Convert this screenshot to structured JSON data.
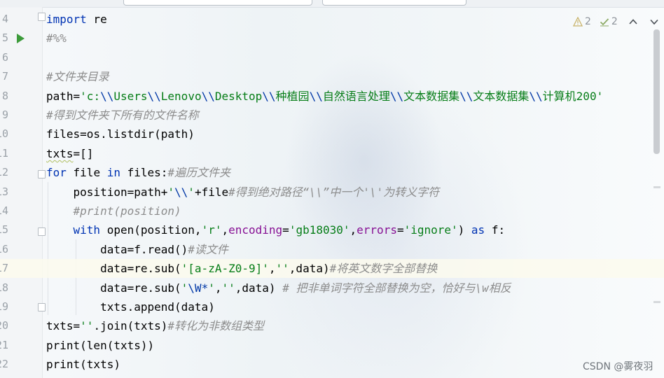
{
  "editor": {
    "lines": [
      {
        "num": "4",
        "tokens": [
          {
            "t": "import",
            "c": "kw"
          },
          {
            "t": " re",
            "c": "bi"
          }
        ]
      },
      {
        "num": "5",
        "tokens": [
          {
            "t": "#%%",
            "c": "cm"
          }
        ]
      },
      {
        "num": "6",
        "tokens": []
      },
      {
        "num": "7",
        "tokens": [
          {
            "t": "#文件夹目录",
            "c": "cm"
          }
        ]
      },
      {
        "num": "8",
        "tokens": [
          {
            "t": "path=",
            "c": "bi"
          },
          {
            "t": "'c:",
            "c": "str"
          },
          {
            "t": "\\\\",
            "c": "esc"
          },
          {
            "t": "Users",
            "c": "str"
          },
          {
            "t": "\\\\",
            "c": "esc"
          },
          {
            "t": "Lenovo",
            "c": "str"
          },
          {
            "t": "\\\\",
            "c": "esc"
          },
          {
            "t": "Desktop",
            "c": "str"
          },
          {
            "t": "\\\\",
            "c": "esc"
          },
          {
            "t": "种植园",
            "c": "str"
          },
          {
            "t": "\\\\",
            "c": "esc"
          },
          {
            "t": "自然语言处理",
            "c": "str"
          },
          {
            "t": "\\\\",
            "c": "esc"
          },
          {
            "t": "文本数据集",
            "c": "str"
          },
          {
            "t": "\\\\",
            "c": "esc"
          },
          {
            "t": "文本数据集",
            "c": "str"
          },
          {
            "t": "\\\\",
            "c": "esc"
          },
          {
            "t": "计算机200'",
            "c": "str"
          }
        ]
      },
      {
        "num": "9",
        "tokens": [
          {
            "t": "#得到文件夹下所有的文件名称",
            "c": "cm"
          }
        ]
      },
      {
        "num": "10",
        "tokens": [
          {
            "t": "files=os.listdir(path)",
            "c": "bi"
          }
        ]
      },
      {
        "num": "11",
        "tokens": [
          {
            "t": "txts",
            "c": "sq"
          },
          {
            "t": "=[]",
            "c": "bi"
          }
        ]
      },
      {
        "num": "12",
        "tokens": [
          {
            "t": "for",
            "c": "kw"
          },
          {
            "t": " file ",
            "c": "bi"
          },
          {
            "t": "in",
            "c": "kw"
          },
          {
            "t": " files:",
            "c": "bi"
          },
          {
            "t": "#遍历文件夹",
            "c": "cm"
          }
        ]
      },
      {
        "num": "13",
        "tokens": [
          {
            "t": "    position=path+",
            "c": "bi"
          },
          {
            "t": "'",
            "c": "str"
          },
          {
            "t": "\\\\",
            "c": "esc"
          },
          {
            "t": "'",
            "c": "str"
          },
          {
            "t": "+file",
            "c": "bi"
          },
          {
            "t": "#得到绝对路径“\\\\”中一个'\\'为转义字符",
            "c": "cm"
          }
        ]
      },
      {
        "num": "14",
        "tokens": [
          {
            "t": "    ",
            "c": "bi"
          },
          {
            "t": "#print(position)",
            "c": "cm"
          }
        ]
      },
      {
        "num": "15",
        "tokens": [
          {
            "t": "    ",
            "c": "bi"
          },
          {
            "t": "with",
            "c": "kw"
          },
          {
            "t": " open(position,",
            "c": "bi"
          },
          {
            "t": "'r'",
            "c": "str"
          },
          {
            "t": ",",
            "c": "bi"
          },
          {
            "t": "encoding",
            "c": "nm"
          },
          {
            "t": "=",
            "c": "bi"
          },
          {
            "t": "'gb18030'",
            "c": "str"
          },
          {
            "t": ",",
            "c": "bi"
          },
          {
            "t": "errors",
            "c": "nm"
          },
          {
            "t": "=",
            "c": "bi"
          },
          {
            "t": "'ignore'",
            "c": "str"
          },
          {
            "t": ") ",
            "c": "bi"
          },
          {
            "t": "as",
            "c": "kw"
          },
          {
            "t": " f:",
            "c": "bi"
          }
        ]
      },
      {
        "num": "16",
        "tokens": [
          {
            "t": "        data=f.read()",
            "c": "bi"
          },
          {
            "t": "#读文件",
            "c": "cm"
          }
        ]
      },
      {
        "num": "17",
        "tokens": [
          {
            "t": "        data=re.sub(",
            "c": "bi"
          },
          {
            "t": "'[a-zA-Z0-9]'",
            "c": "str"
          },
          {
            "t": ",",
            "c": "bi"
          },
          {
            "t": "''",
            "c": "str"
          },
          {
            "t": ",data)",
            "c": "bi"
          },
          {
            "t": "#将英文数字全部替换",
            "c": "cm"
          }
        ]
      },
      {
        "num": "18",
        "tokens": [
          {
            "t": "        data=re.sub(",
            "c": "bi"
          },
          {
            "t": "'",
            "c": "str"
          },
          {
            "t": "\\W*",
            "c": "esc"
          },
          {
            "t": "'",
            "c": "str"
          },
          {
            "t": ",",
            "c": "bi"
          },
          {
            "t": "''",
            "c": "str"
          },
          {
            "t": ",data) ",
            "c": "bi"
          },
          {
            "t": "# 把非单词字符全部替换为空，恰好与\\w相反",
            "c": "cm"
          }
        ]
      },
      {
        "num": "19",
        "tokens": [
          {
            "t": "        txts.append(data)",
            "c": "bi"
          }
        ]
      },
      {
        "num": "20",
        "tokens": [
          {
            "t": "txts=",
            "c": "bi"
          },
          {
            "t": "''",
            "c": "str"
          },
          {
            "t": ".join(txts)",
            "c": "bi"
          },
          {
            "t": "#转化为非数组类型",
            "c": "cm"
          }
        ]
      },
      {
        "num": "21",
        "tokens": [
          {
            "t": "print(len(txts))",
            "c": "bi"
          }
        ]
      },
      {
        "num": "22",
        "tokens": [
          {
            "t": "print(txts)",
            "c": "bi"
          }
        ]
      }
    ]
  },
  "inspections": {
    "warnings": "2",
    "weak_warnings": "2",
    "warn_icon": "warning-triangle-icon",
    "ok_icon": "check-icon"
  },
  "watermark": "CSDN @雾夜羽",
  "colors": {
    "keyword": "#0033b3",
    "string": "#067d17",
    "comment": "#8c8c8c",
    "run": "#3c9b3a"
  }
}
